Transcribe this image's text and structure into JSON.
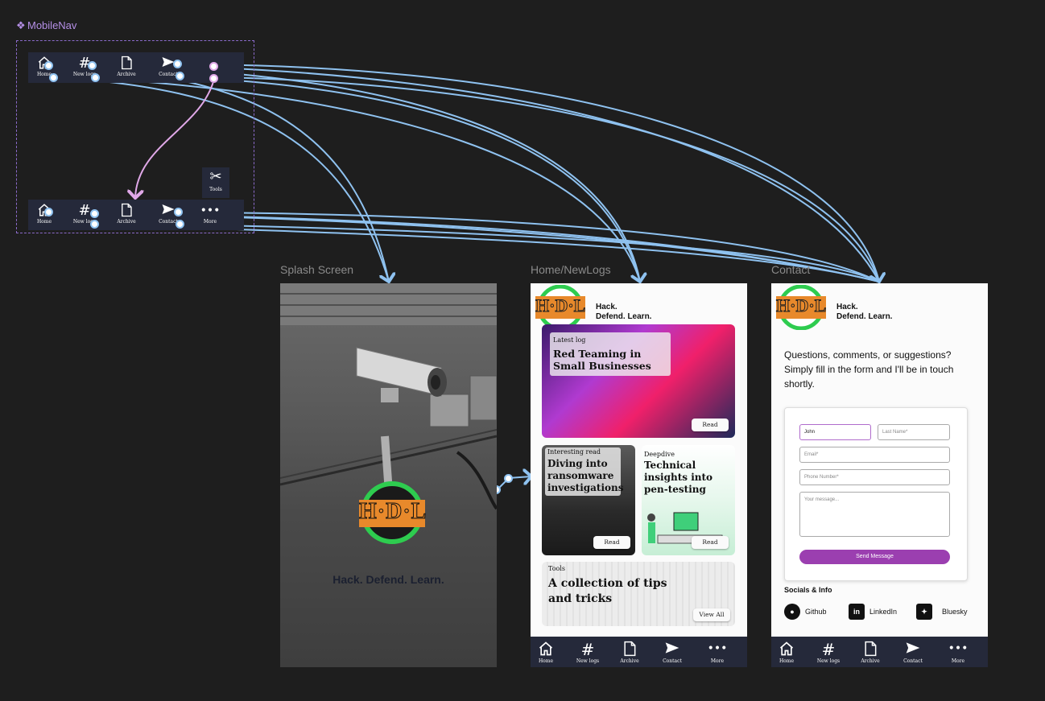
{
  "component": {
    "label": "MobileNav",
    "icon_name": "component-diamond-icon"
  },
  "mini_nav": {
    "items": [
      {
        "label": "Home",
        "icon": "home-icon"
      },
      {
        "label": "New logs",
        "icon": "hash-icon"
      },
      {
        "label": "Archive",
        "icon": "document-icon"
      },
      {
        "label": "Contact",
        "icon": "send-icon"
      },
      {
        "label": "More",
        "icon": "more-icon"
      }
    ],
    "tools_label": "Tools",
    "tools_icon": "tools-icon"
  },
  "frames": {
    "splash": {
      "label": "Splash Screen",
      "tagline": "Hack. Defend. Learn."
    },
    "home": {
      "label": "Home/NewLogs"
    },
    "contact": {
      "label": "Contact"
    }
  },
  "brand": {
    "logo_text": "H·D·L",
    "line1": "Hack.",
    "line2": "Defend. Learn."
  },
  "home": {
    "latest": {
      "kicker": "Latest log",
      "title": "Red Teaming in Small Businesses",
      "button": "Read"
    },
    "interesting": {
      "kicker": "Interesting read",
      "title": "Diving into ransomware investigations",
      "button": "Read"
    },
    "deepdive": {
      "kicker": "Deepdive",
      "title": "Technical insights into pen-testing",
      "button": "Read"
    },
    "tools": {
      "kicker": "Tools",
      "title": "A collection of tips and tricks",
      "button": "View All"
    }
  },
  "bottom_nav": {
    "items": [
      {
        "label": "Home",
        "icon": "home-icon"
      },
      {
        "label": "New logs",
        "icon": "hash-icon"
      },
      {
        "label": "Archive",
        "icon": "document-icon"
      },
      {
        "label": "Contact",
        "icon": "send-icon"
      },
      {
        "label": "More",
        "icon": "more-icon"
      }
    ]
  },
  "contact": {
    "intro": "Questions, comments, or suggestions? Simply fill in the form and I'll be in touch shortly.",
    "form": {
      "first_name_value": "John",
      "last_name_placeholder": "Last Name*",
      "email_placeholder": "Email*",
      "phone_placeholder": "Phone Number*",
      "message_placeholder": "Your message...",
      "send_label": "Send Message"
    },
    "socials_heading": "Socials & Info",
    "socials": [
      {
        "label": "Github",
        "icon": "github-icon"
      },
      {
        "label": "LinkedIn",
        "icon": "linkedin-icon"
      },
      {
        "label": "Bluesky",
        "icon": "bluesky-icon"
      }
    ]
  },
  "colors": {
    "canvas": "#1e1e1e",
    "nav_bg": "#25293a",
    "wire": "#8fc2f0",
    "accent_purple": "#9b3fb0",
    "logo_green": "#2ecc4f",
    "logo_orange": "#e8892b"
  }
}
